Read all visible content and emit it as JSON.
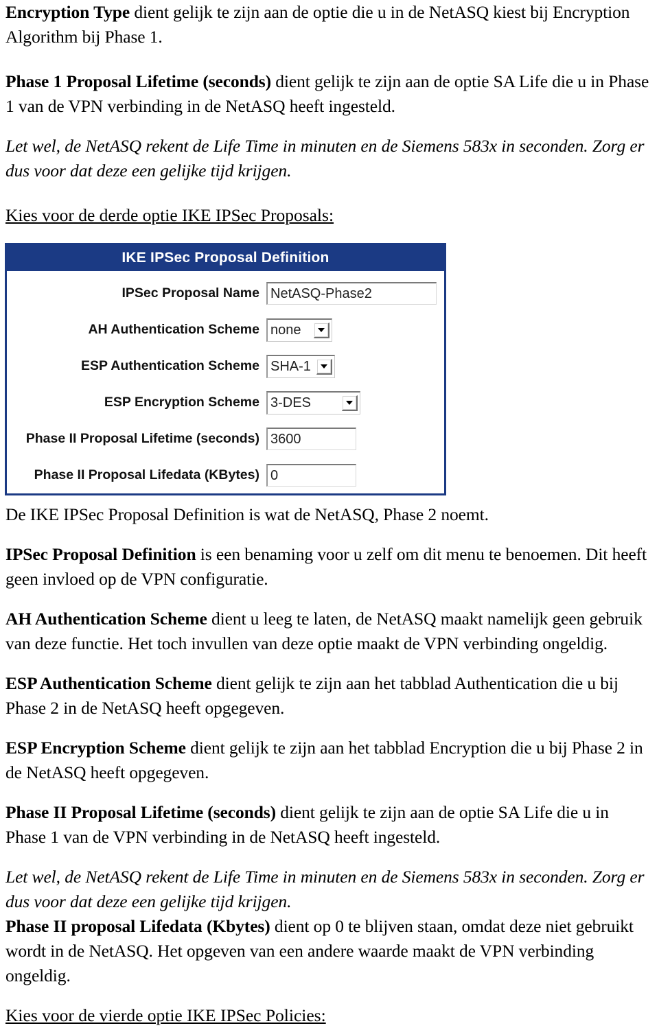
{
  "document": {
    "paragraphs": [
      {
        "id": "p-encryption-type",
        "style": "normal",
        "bold_lead": "Encryption Type",
        "rest": " dient gelijk te zijn aan de optie die u in de NetASQ kiest bij Encryption Algorithm bij Phase 1."
      },
      {
        "id": "p-phase1-lifetime",
        "style": "normal",
        "bold_lead": "Phase 1 Proposal Lifetime (seconds)",
        "rest": " dient gelijk te zijn aan de optie SA Life die u in Phase 1 van de VPN verbinding in de NetASQ heeft ingesteld."
      },
      {
        "id": "p-note-lifetime-1",
        "style": "italic",
        "bold_lead": "",
        "rest": "Let wel, de NetASQ rekent de Life Time in minuten en de Siemens 583x in seconden. Zorg er dus voor dat deze een gelijke tijd krijgen."
      }
    ],
    "link_before_shot": "Kies voor de derde optie IKE IPSec Proposals:",
    "paragraphs_after": [
      {
        "id": "p-definition-intro",
        "style": "normal",
        "bold_lead": "",
        "rest": "De IKE IPSec Proposal Definition is wat de NetASQ, Phase 2 noemt."
      },
      {
        "id": "p-ipsec-proposal-definition",
        "style": "normal",
        "bold_lead": "IPSec Proposal Definition",
        "rest": " is een benaming voor u zelf om dit menu te benoemen. Dit heeft geen invloed op de VPN configuratie."
      },
      {
        "id": "p-ah-auth-scheme",
        "style": "normal",
        "bold_lead": "AH Authentication Scheme",
        "rest": " dient u leeg te laten, de NetASQ maakt namelijk geen gebruik van deze functie. Het toch invullen van deze optie maakt de VPN verbinding ongeldig."
      },
      {
        "id": "p-esp-auth-scheme",
        "style": "normal",
        "bold_lead": "ESP Authentication Scheme",
        "rest": " dient gelijk te zijn aan het tabblad Authentication die u bij Phase 2 in de NetASQ heeft opgegeven."
      },
      {
        "id": "p-esp-encryption-scheme",
        "style": "normal",
        "bold_lead": "ESP Encryption Scheme",
        "rest": " dient gelijk te zijn aan het tabblad Encryption die u bij Phase 2 in de NetASQ heeft opgegeven."
      },
      {
        "id": "p-phase2-lifetime",
        "style": "normal",
        "bold_lead": "Phase II Proposal Lifetime (seconds)",
        "rest": " dient gelijk te zijn aan de optie SA Life die u in Phase 1 van de VPN verbinding in de NetASQ heeft ingesteld."
      },
      {
        "id": "p-note-lifetime-2",
        "style": "italic",
        "bold_lead": "",
        "rest": "Let wel, de NetASQ rekent de Life Time in minuten en de Siemens 583x in seconden. Zorg er dus voor dat deze een gelijke tijd krijgen."
      },
      {
        "id": "p-phase2-lifedata",
        "style": "normal",
        "bold_lead": "Phase II proposal Lifedata (Kbytes)",
        "rest": " dient op 0 te blijven staan, omdat deze niet gebruikt wordt in de NetASQ. Het opgeven van een andere waarde maakt de VPN verbinding ongeldig."
      }
    ],
    "link_after": "Kies voor de vierde optie IKE IPSec Policies:"
  },
  "screenshot": {
    "title": "IKE IPSec Proposal Definition",
    "accent_color": "#1b3a84",
    "fields": [
      {
        "id": "ipsec-proposal-name",
        "label": "IPSec Proposal Name",
        "type": "text",
        "value": "NetASQ-Phase2"
      },
      {
        "id": "ah-authentication-scheme",
        "label": "AH Authentication Scheme",
        "type": "select",
        "value": "none"
      },
      {
        "id": "esp-authentication-scheme",
        "label": "ESP Authentication Scheme",
        "type": "select",
        "value": "SHA-1"
      },
      {
        "id": "esp-encryption-scheme",
        "label": "ESP Encryption Scheme",
        "type": "select",
        "value": "3-DES"
      },
      {
        "id": "phase2-proposal-lifetime",
        "label": "Phase II Proposal Lifetime (seconds)",
        "type": "text",
        "value": "3600"
      },
      {
        "id": "phase2-proposal-lifedata",
        "label": "Phase II Proposal Lifedata (KBytes)",
        "type": "text",
        "value": "0"
      }
    ]
  }
}
